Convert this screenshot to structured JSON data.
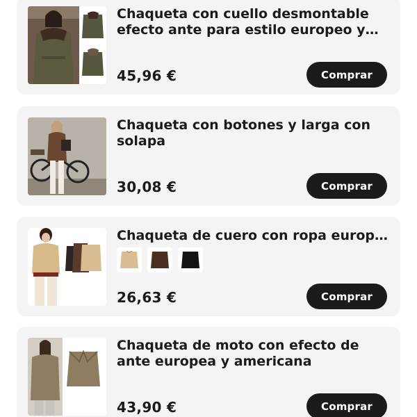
{
  "products": [
    {
      "title": "Chaqueta con cuello desmontable efecto ante para estilo europeo y a...",
      "price": "45,96 €",
      "button": "Comprar",
      "image": "woman-olive-fur-collar-jacket"
    },
    {
      "title": "Chaqueta con botones y larga con solapa",
      "price": "30,08 €",
      "button": "Comprar",
      "image": "woman-brown-jacket-with-bicycle"
    },
    {
      "title": "Chaqueta de cuero con ropa europe...",
      "price": "26,63 €",
      "button": "Comprar",
      "image": "woman-beige-leather-jacket",
      "swatches": [
        "beige",
        "dark-brown",
        "black"
      ]
    },
    {
      "title": "Chaqueta de moto con efecto de ante europea y americana",
      "price": "43,90 €",
      "button": "Comprar",
      "image": "woman-khaki-moto-jacket"
    }
  ],
  "colors": {
    "card_bg": "#f4f4f4",
    "button_bg": "#1b1b1b",
    "button_text": "#ffffff",
    "text": "#1b1b1b"
  }
}
